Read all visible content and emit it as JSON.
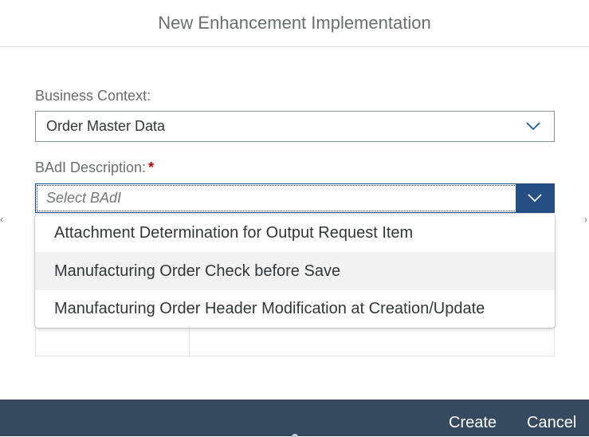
{
  "dialog": {
    "title": "New Enhancement Implementation"
  },
  "business_context": {
    "label": "Business Context:",
    "value": "Order Master Data"
  },
  "badi_description": {
    "label": "BAdI Description:",
    "required_marker": "*",
    "placeholder": "Select BAdI"
  },
  "dropdown": {
    "items": [
      {
        "label": "Attachment Determination for Output Request Item"
      },
      {
        "label": "Manufacturing Order Check before Save"
      },
      {
        "label": "Manufacturing Order Header Modification at Creation/Update"
      }
    ]
  },
  "footer": {
    "create_label": "Create",
    "cancel_label": "Cancel"
  },
  "icons": {
    "dropdown_arrow": "chevron-down-icon"
  },
  "colors": {
    "footer_bg": "#354a5f",
    "accent": "#244e84",
    "required": "#bb0000",
    "hover_row": "#f2f2f2"
  }
}
